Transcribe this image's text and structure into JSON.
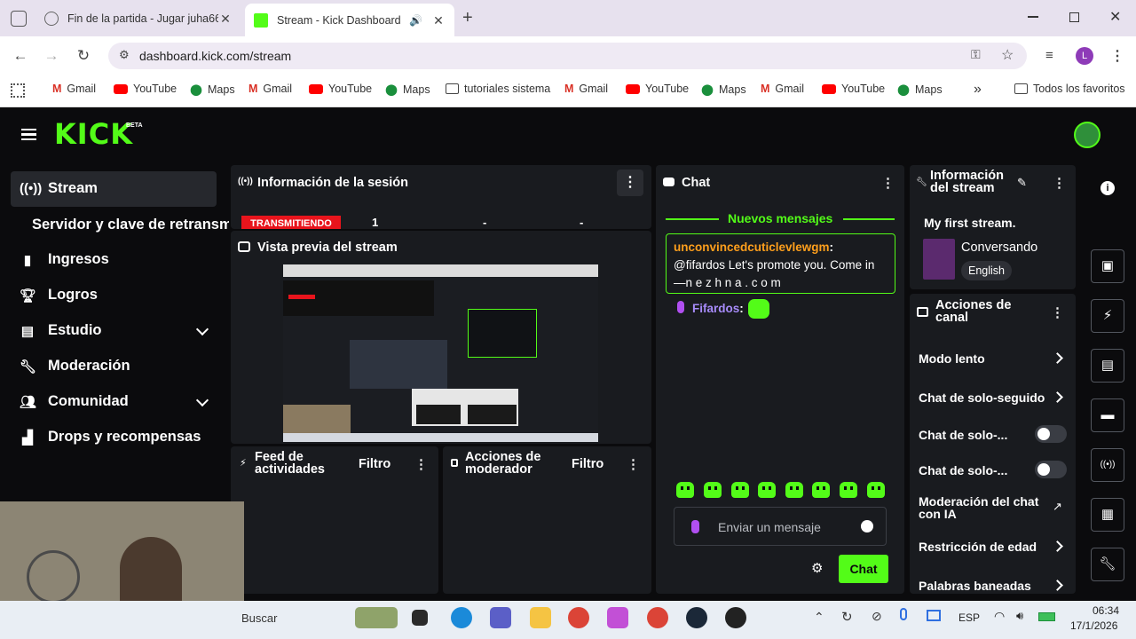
{
  "browser": {
    "tabs": [
      {
        "title": "Fin de la partida - Jugar juha66"
      },
      {
        "title": "Stream - Kick Dashboard"
      }
    ],
    "url": "dashboard.kick.com/stream",
    "bookmarks": [
      "Gmail",
      "YouTube",
      "Maps",
      "Gmail",
      "YouTube",
      "Maps",
      "tutoriales sistema",
      "Gmail",
      "YouTube",
      "Maps",
      "Gmail",
      "YouTube",
      "Maps"
    ],
    "all_bookmarks": "Todos los favoritos",
    "profile_initial": "L"
  },
  "kick": {
    "logo": "KICK",
    "beta": "BETA",
    "accent": "#53fc18",
    "sidebar": {
      "items": [
        {
          "label": "Stream",
          "icon": "broadcast-icon"
        },
        {
          "label": "Servidor y clave de retransmisión",
          "icon": ""
        },
        {
          "label": "Ingresos",
          "icon": "bar-chart-icon"
        },
        {
          "label": "Logros",
          "icon": "trophy-icon"
        },
        {
          "label": "Estudio",
          "icon": "layout-icon"
        },
        {
          "label": "Moderación",
          "icon": "wrench-icon"
        },
        {
          "label": "Comunidad",
          "icon": "users-icon"
        },
        {
          "label": "Drops y recompensas",
          "icon": "gift-icon"
        }
      ]
    },
    "session": {
      "title": "Información de la sesión",
      "status": "TRANSMITIENDO",
      "stats": [
        "1",
        "-",
        "-"
      ]
    },
    "preview": {
      "title": "Vista previa del stream"
    },
    "feed": {
      "title": "Feed de actividades",
      "filter": "Filtro"
    },
    "modactions": {
      "title": "Acciones de moderador",
      "filter": "Filtro"
    },
    "chat": {
      "title": "Chat",
      "new_messages": "Nuevos mensajes",
      "messages": [
        {
          "user": "unconvincedcuticlevlewgm",
          "text": "@fifardos Let's promote you. Come in",
          "text2": "—n e z h n a . c o m"
        },
        {
          "user": "Fifardos",
          "text": ""
        }
      ],
      "placeholder": "Enviar un mensaje",
      "send": "Chat"
    },
    "stream_info": {
      "title": "Información del stream",
      "stream_title": "My first stream.",
      "category": "Conversando",
      "language": "English"
    },
    "channel_actions": {
      "title": "Acciones de canal",
      "items": [
        "Modo lento",
        "Chat de solo-seguidores",
        "Chat de solo-...",
        "Chat de solo-...",
        "Moderación del chat con IA",
        "Restricción de edad",
        "Palabras baneadas"
      ]
    }
  },
  "taskbar": {
    "search": "Buscar",
    "lang": "ESP",
    "time": "06:34",
    "date": "17/1/2026"
  }
}
